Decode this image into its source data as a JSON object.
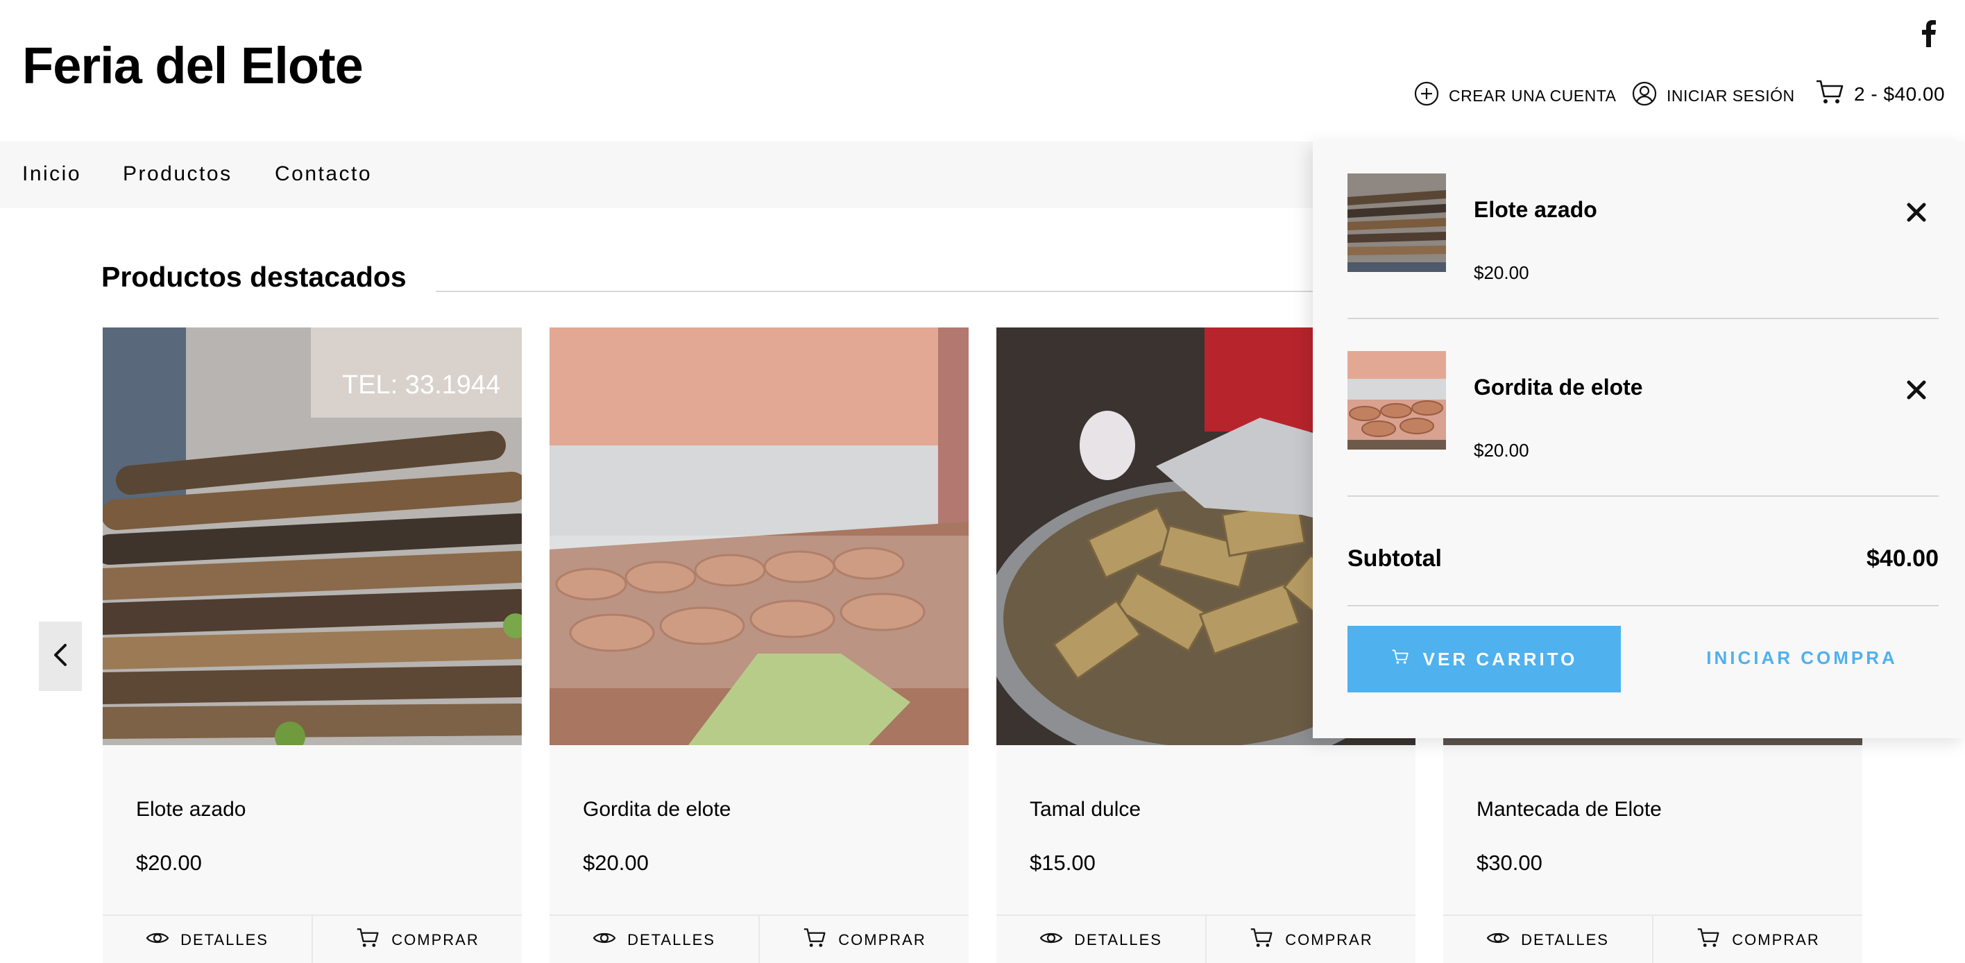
{
  "header": {
    "site_title": "Feria del Elote",
    "create_account_label": "CREAR UNA CUENTA",
    "login_label": "INICIAR SESIÓN",
    "cart_summary": "2 - $40.00",
    "social_icon": "facebook-icon"
  },
  "nav": {
    "items": [
      {
        "label": "Inicio"
      },
      {
        "label": "Productos"
      },
      {
        "label": "Contacto"
      }
    ]
  },
  "section": {
    "title": "Productos destacados"
  },
  "products": [
    {
      "name": "Elote azado",
      "price": "$20.00",
      "details_label": "DETALLES",
      "buy_label": "COMPRAR",
      "image": "grilled-corn-photo"
    },
    {
      "name": "Gordita de elote",
      "price": "$20.00",
      "details_label": "DETALLES",
      "buy_label": "COMPRAR",
      "image": "corn-gorditas-photo"
    },
    {
      "name": "Tamal dulce",
      "price": "$15.00",
      "details_label": "DETALLES",
      "buy_label": "COMPRAR",
      "image": "tamales-pot-photo"
    },
    {
      "name": "Mantecada de Elote",
      "price": "$30.00",
      "details_label": "DETALLES",
      "buy_label": "COMPRAR",
      "image": "mantecada-photo"
    }
  ],
  "cart": {
    "items": [
      {
        "name": "Elote azado",
        "price": "$20.00"
      },
      {
        "name": "Gordita de elote",
        "price": "$20.00"
      }
    ],
    "subtotal_label": "Subtotal",
    "subtotal_value": "$40.00",
    "view_cart_label": "VER CARRITO",
    "checkout_label": "INICIAR COMPRA"
  },
  "colors": {
    "accent": "#4fb1ee",
    "nav_background": "#f7f7f7",
    "card_background": "#f8f8f8"
  }
}
